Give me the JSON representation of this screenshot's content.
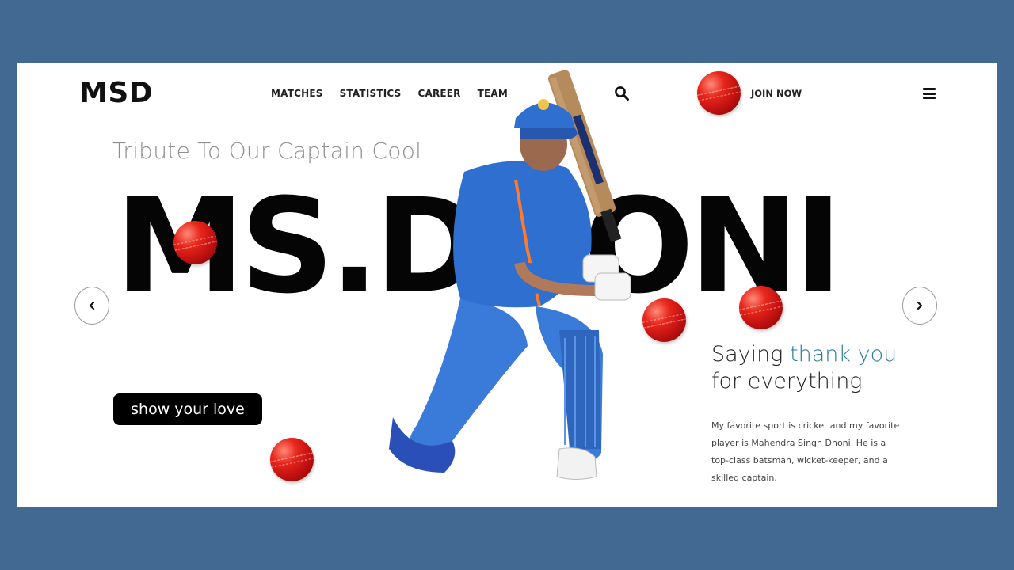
{
  "brand": {
    "logo": "MSD"
  },
  "nav": {
    "items": [
      "MATCHES",
      "STATISTICS",
      "CAREER",
      "TEAM"
    ]
  },
  "header": {
    "join_label": "JOIN NOW",
    "search_icon": "search-icon",
    "menu_icon": "hamburger-menu-icon"
  },
  "hero": {
    "tagline": "Tribute To Our Captain Cool",
    "big_name": "MS.DHONI",
    "cta_label": "show your love",
    "prev_icon": "chevron-left-icon",
    "next_icon": "chevron-right-icon"
  },
  "message": {
    "line1_prefix": "Saying ",
    "line1_highlight": "thank you",
    "line2": "for everything",
    "description": "My favorite sport is cricket and my favorite player is Mahendra Singh Dhoni. He is a top-class batsman, wicket-keeper, and a skilled captain."
  },
  "colors": {
    "frame": "#426991",
    "card": "#ffffff",
    "accent": "#2a7d9c",
    "button": "#000000",
    "ball": "#d81e16",
    "jersey": "#2f6fd0"
  }
}
